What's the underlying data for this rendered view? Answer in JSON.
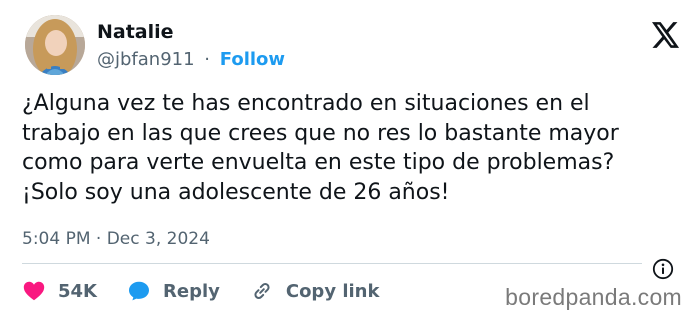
{
  "author": {
    "display_name": "Natalie",
    "handle": "@jbfan911",
    "separator": "·",
    "follow_label": "Follow"
  },
  "tweet": {
    "lines": [
      "¿Alguna vez te has encontrado en situaciones en el",
      "trabajo en las que crees que no res lo bastante mayor",
      "como para verte envuelta en este tipo de problemas?",
      "¡Solo soy una adolescente de 26 años!"
    ]
  },
  "meta": {
    "time": "5:04 PM",
    "separator": "·",
    "date": "Dec 3, 2024"
  },
  "actions": {
    "like_count": "54K",
    "reply_label": "Reply",
    "copy_link_label": "Copy link"
  },
  "watermark": "boredpanda.com",
  "colors": {
    "accent": "#1d9bf0",
    "like": "#f91880",
    "reply": "#1d9bf0",
    "muted": "#536471"
  },
  "icons": {
    "brand": "x-logo-icon",
    "info": "info-icon",
    "like": "heart-icon",
    "reply": "speech-bubble-icon",
    "copy": "link-icon"
  }
}
